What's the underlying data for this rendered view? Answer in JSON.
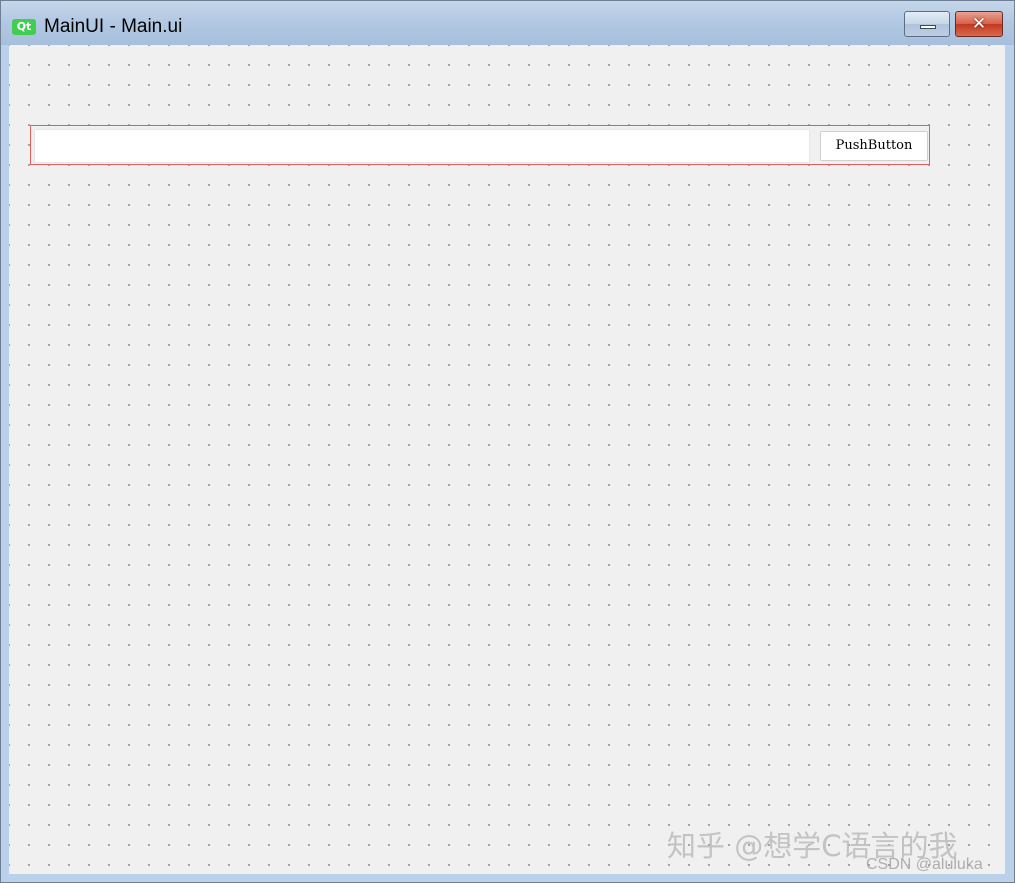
{
  "window": {
    "title": "MainUI - Main.ui",
    "icon": "qt-logo-icon",
    "logo_text": "Qt",
    "controls": {
      "minimize_icon": "minimize-icon",
      "close_icon": "close-icon",
      "close_glyph": "✕"
    }
  },
  "form": {
    "line_edit": {
      "value": "",
      "placeholder": ""
    },
    "push_button": {
      "label": "PushButton"
    },
    "layout_border_color": "#e06060"
  },
  "watermark": {
    "main": "知乎 @想学C语言的我",
    "secondary": "CSDN @aluluka"
  },
  "colors": {
    "titlebar": "#b3c9e3",
    "frame": "#b9d1ea",
    "client_bg": "#f0f0f0",
    "grid_dot": "#8e8e8e",
    "qt_green": "#41cd52",
    "close_red": "#c2391f"
  }
}
